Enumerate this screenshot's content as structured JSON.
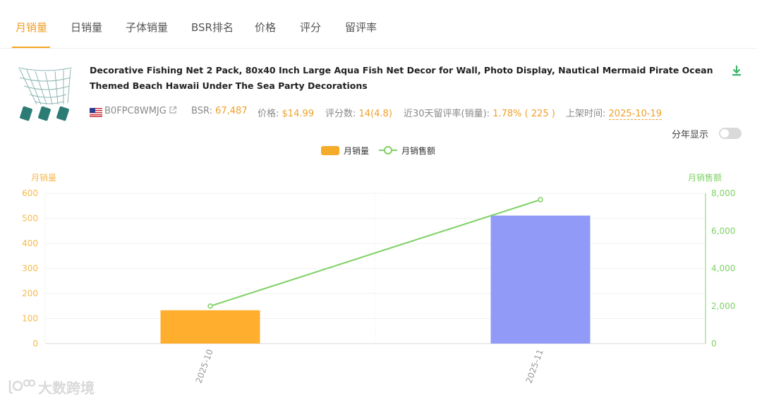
{
  "tabs": [
    {
      "label": "月销量",
      "active": true
    },
    {
      "label": "日销量"
    },
    {
      "label": "子体销量"
    },
    {
      "label": "BSR排名"
    },
    {
      "label": "价格"
    },
    {
      "label": "评分"
    },
    {
      "label": "留评率"
    }
  ],
  "product": {
    "title": "Decorative Fishing Net 2 Pack, 80x40 Inch Large Aqua Fish Net Decor for Wall, Photo Display, Nautical Mermaid Pirate Ocean Themed Beach Hawaii Under The Sea Party Decorations",
    "asin": "B0FPC8WMJG",
    "bsr_label": "BSR:",
    "bsr_value": "67,487",
    "price_label": "价格:",
    "price_value": "$14.99",
    "rating_label": "评分数:",
    "rating_value": "14(4.8)",
    "review_rate_label": "近30天留评率(销量):",
    "review_rate_value": "1.78% ( 225 )",
    "listed_label": "上架时间:",
    "listed_value": "2025-10-19",
    "flag_icon": "us-flag-icon",
    "accent_color": "#f0a02a"
  },
  "toggle": {
    "label": "分年显示",
    "on": false
  },
  "watermark": {
    "text": "大数跨境"
  },
  "chart_data": {
    "type": "bar",
    "categories": [
      "2025-10",
      "2025-11"
    ],
    "series": [
      {
        "name": "月销量",
        "type": "bar",
        "axis": "left",
        "values": [
          133,
          511
        ],
        "colors": [
          "#ffae2e",
          "#919bf7"
        ]
      },
      {
        "name": "月销售额",
        "type": "line",
        "axis": "right",
        "values": [
          1994,
          7660
        ],
        "color": "#7fd164"
      }
    ],
    "ylabel": "月销量",
    "y2label": "月销售额",
    "ylim": [
      0,
      600
    ],
    "y2lim": [
      0,
      8000
    ],
    "yticks": [
      "0",
      "100",
      "200",
      "300",
      "400",
      "500",
      "600"
    ],
    "y2ticks": [
      "0",
      "2,000",
      "4,000",
      "6,000",
      "8,000"
    ],
    "left_axis_color": "#f5b94d",
    "right_axis_color": "#7fd164",
    "grid": true,
    "legend": "top-center"
  }
}
